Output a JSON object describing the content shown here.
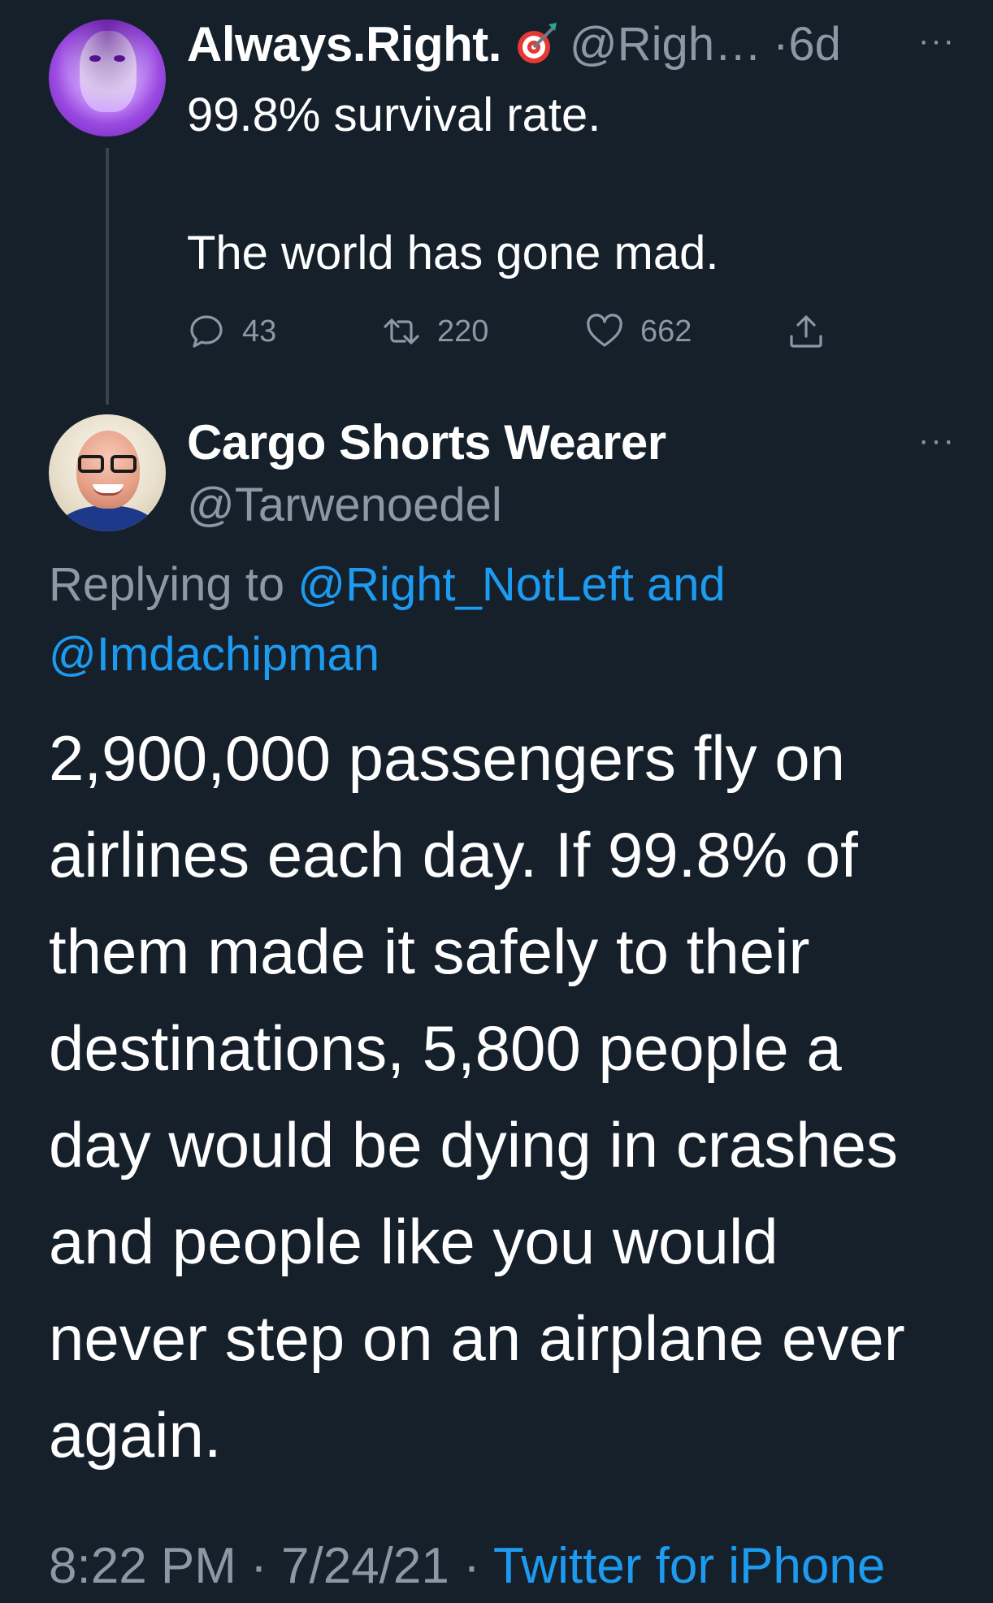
{
  "parent_tweet": {
    "display_name": "Always.Right.",
    "name_emoji": "direct-hit-target-emoji",
    "handle": "@Righ…",
    "time": "·6d",
    "more": "···",
    "text_line1": "99.8% survival rate.",
    "text_line2": "The world has gone mad.",
    "actions": {
      "reply_count": "43",
      "retweet_count": "220",
      "like_count": "662"
    }
  },
  "reply_tweet": {
    "display_name": "Cargo Shorts Wearer",
    "handle": "@Tarwenoedel",
    "more": "···",
    "replying_prefix": "Replying to ",
    "replying_link1": "@Right_NotLeft and",
    "replying_link2": "@Imdachipman",
    "body_lines": [
      "2,900,000 passengers fly on",
      "airlines each day.  If 99.8% of",
      "them made it safely to their",
      "destinations, 5,800 people a",
      "day would be dying in crashes",
      "and people like you would",
      "never step on an airplane ever",
      "again."
    ],
    "footer": {
      "time": "8:22 PM",
      "separator1": " · ",
      "date": "7/24/21",
      "separator2": " · ",
      "source": "Twitter for iPhone"
    }
  },
  "colors": {
    "background": "#15202b",
    "text": "#ffffff",
    "muted": "#8b98a5",
    "link": "#1d9bf0",
    "thread_line": "#38444d"
  }
}
